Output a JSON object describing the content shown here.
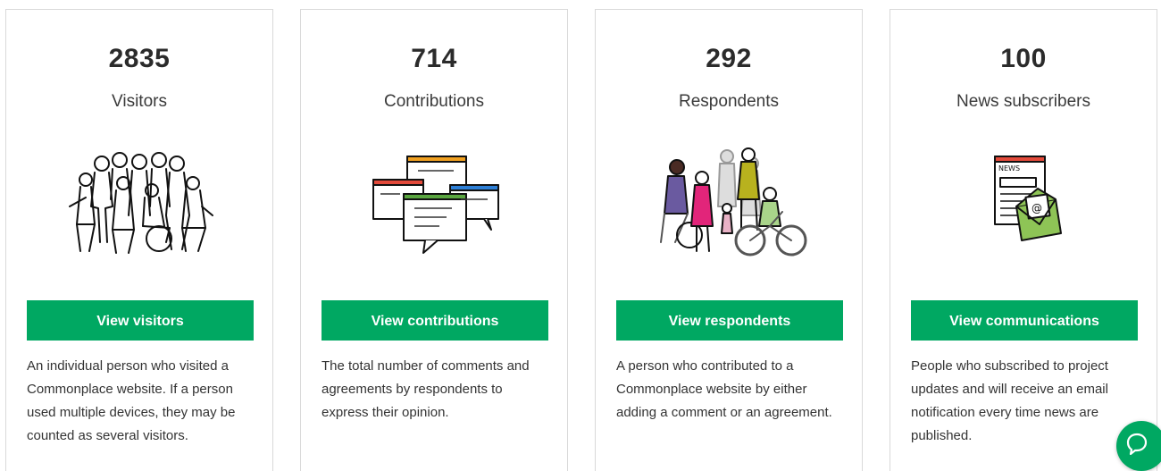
{
  "stats": [
    {
      "count": "2835",
      "label": "Visitors",
      "button": "View visitors",
      "description": "An individual person who visited a Commonplace website. If a person used multiple devices, they may be counted as several visitors.",
      "icon": "people-crowd-icon"
    },
    {
      "count": "714",
      "label": "Contributions",
      "button": "View contributions",
      "description": "The total number of comments and agreements by respondents to express their opinion.",
      "icon": "comment-cards-icon"
    },
    {
      "count": "292",
      "label": "Respondents",
      "button": "View respondents",
      "description": "A person who contributed to a Commonplace website by either adding a comment or an agreement.",
      "icon": "respondents-group-icon"
    },
    {
      "count": "100",
      "label": "News subscribers",
      "button": "View communications",
      "description": "People who subscribed to project updates and will receive an email notification every time news are published.",
      "icon": "newsletter-email-icon"
    }
  ],
  "chat": {
    "icon": "chat-bubble-icon"
  },
  "colors": {
    "accent": "#00a862",
    "border": "#d9d9d9",
    "text": "#333333"
  }
}
